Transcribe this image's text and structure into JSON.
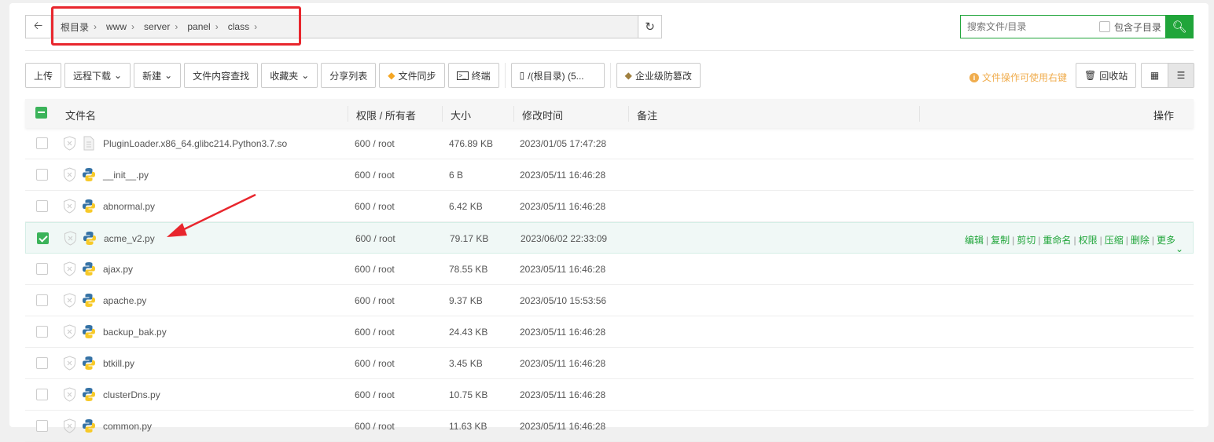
{
  "path": {
    "crumbs": [
      "根目录",
      "www",
      "server",
      "panel",
      "class"
    ]
  },
  "search": {
    "placeholder": "搜索文件/目录",
    "include_sub": "包含子目录"
  },
  "toolbar": [
    "上传",
    "远程下载",
    "新建",
    "文件内容查找",
    "收藏夹",
    "分享列表",
    "文件同步",
    "终端",
    "/(根目录) (5...",
    "企业级防篡改"
  ],
  "tip": "文件操作可使用右键",
  "recycle": "回收站",
  "columns": {
    "name": "文件名",
    "perm": "权限 / 所有者",
    "size": "大小",
    "mtime": "修改时间",
    "note": "备注",
    "ops": "操作"
  },
  "ops": [
    "编辑",
    "复制",
    "剪切",
    "重命名",
    "权限",
    "压缩",
    "删除",
    "更多"
  ],
  "files": [
    {
      "name": "PluginLoader.x86_64.glibc214.Python3.7.so",
      "perm": "600 / root",
      "size": "476.89 KB",
      "mtime": "2023/01/05 17:47:28",
      "type": "file"
    },
    {
      "name": "__init__.py",
      "perm": "600 / root",
      "size": "6 B",
      "mtime": "2023/05/11 16:46:28",
      "type": "py"
    },
    {
      "name": "abnormal.py",
      "perm": "600 / root",
      "size": "6.42 KB",
      "mtime": "2023/05/11 16:46:28",
      "type": "py"
    },
    {
      "name": "acme_v2.py",
      "perm": "600 / root",
      "size": "79.17 KB",
      "mtime": "2023/06/02 22:33:09",
      "type": "py",
      "selected": true
    },
    {
      "name": "ajax.py",
      "perm": "600 / root",
      "size": "78.55 KB",
      "mtime": "2023/05/11 16:46:28",
      "type": "py"
    },
    {
      "name": "apache.py",
      "perm": "600 / root",
      "size": "9.37 KB",
      "mtime": "2023/05/10 15:53:56",
      "type": "py"
    },
    {
      "name": "backup_bak.py",
      "perm": "600 / root",
      "size": "24.43 KB",
      "mtime": "2023/05/11 16:46:28",
      "type": "py"
    },
    {
      "name": "btkill.py",
      "perm": "600 / root",
      "size": "3.45 KB",
      "mtime": "2023/05/11 16:46:28",
      "type": "py"
    },
    {
      "name": "clusterDns.py",
      "perm": "600 / root",
      "size": "10.75 KB",
      "mtime": "2023/05/11 16:46:28",
      "type": "py"
    },
    {
      "name": "common.py",
      "perm": "600 / root",
      "size": "11.63 KB",
      "mtime": "2023/05/11 16:46:28",
      "type": "py"
    }
  ]
}
